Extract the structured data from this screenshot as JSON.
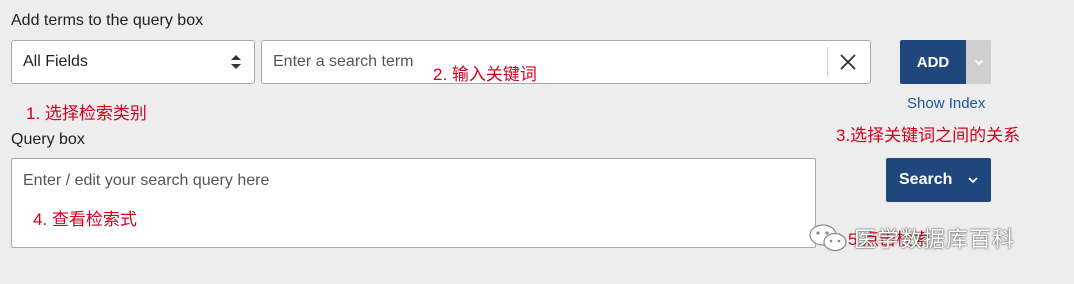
{
  "builder": {
    "heading": "Add terms to the query box",
    "field_select_value": "All Fields",
    "search_placeholder": "Enter a search term",
    "add_label": "ADD",
    "show_index_label": "Show Index"
  },
  "query": {
    "heading": "Query box",
    "placeholder": "Enter / edit your search query here",
    "search_label": "Search"
  },
  "annotations": {
    "step1": "1. 选择检索类别",
    "step2": "2. 输入关键词",
    "step3": "3.选择关键词之间的关系",
    "step4": "4. 查看检索式",
    "step5": "5.点击检索"
  },
  "watermark": {
    "text": "医学数据库百科",
    "icon": "wechat-icon"
  },
  "colors": {
    "primary_button": "#20467e",
    "link": "#20569a",
    "annotation": "#d0021b",
    "background": "#ededed"
  }
}
